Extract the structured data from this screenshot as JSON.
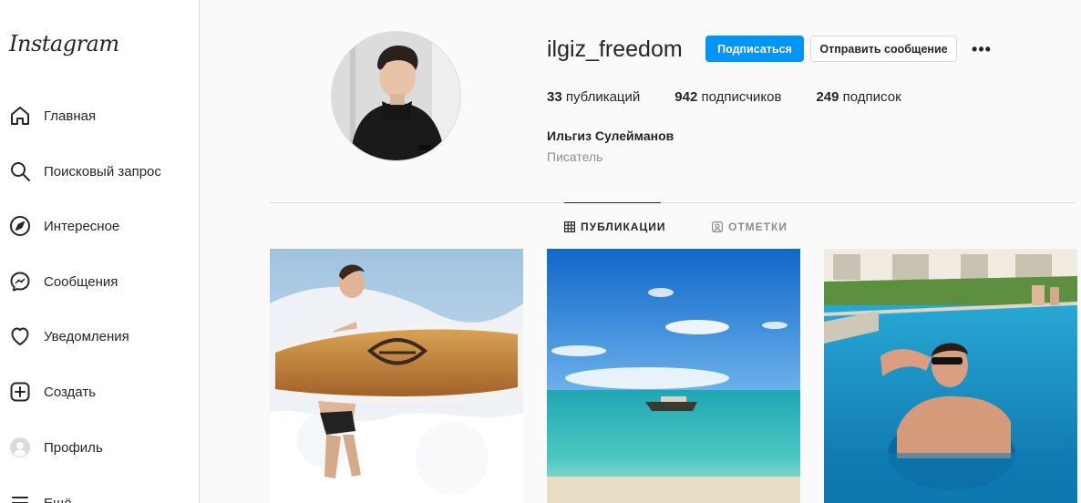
{
  "sidebar": {
    "logo": "Instagram",
    "items": [
      {
        "label": "Главная",
        "icon": "home-icon"
      },
      {
        "label": "Поисковый запрос",
        "icon": "search-icon"
      },
      {
        "label": "Интересное",
        "icon": "compass-icon"
      },
      {
        "label": "Сообщения",
        "icon": "messenger-icon"
      },
      {
        "label": "Уведомления",
        "icon": "heart-icon"
      },
      {
        "label": "Создать",
        "icon": "plus-square-icon"
      },
      {
        "label": "Профиль",
        "icon": "avatar-icon"
      },
      {
        "label": "Ещё",
        "icon": "menu-icon"
      }
    ]
  },
  "profile": {
    "username": "ilgiz_freedom",
    "follow_label": "Подписаться",
    "message_label": "Отправить сообщение",
    "more_label": "•••",
    "posts_count": "33",
    "posts_label": "публикаций",
    "followers_count": "942",
    "followers_label": "подписчиков",
    "following_count": "249",
    "following_label": "подписок",
    "full_name": "Ильгиз Сулейманов",
    "bio": "Писатель"
  },
  "tabs": {
    "posts": "ПУБЛИКАЦИИ",
    "tagged": "ОТМЕТКИ"
  },
  "colors": {
    "accent": "#0095f6",
    "text": "#262626",
    "secondary": "#8e8e8e",
    "border": "#dbdbdb"
  }
}
